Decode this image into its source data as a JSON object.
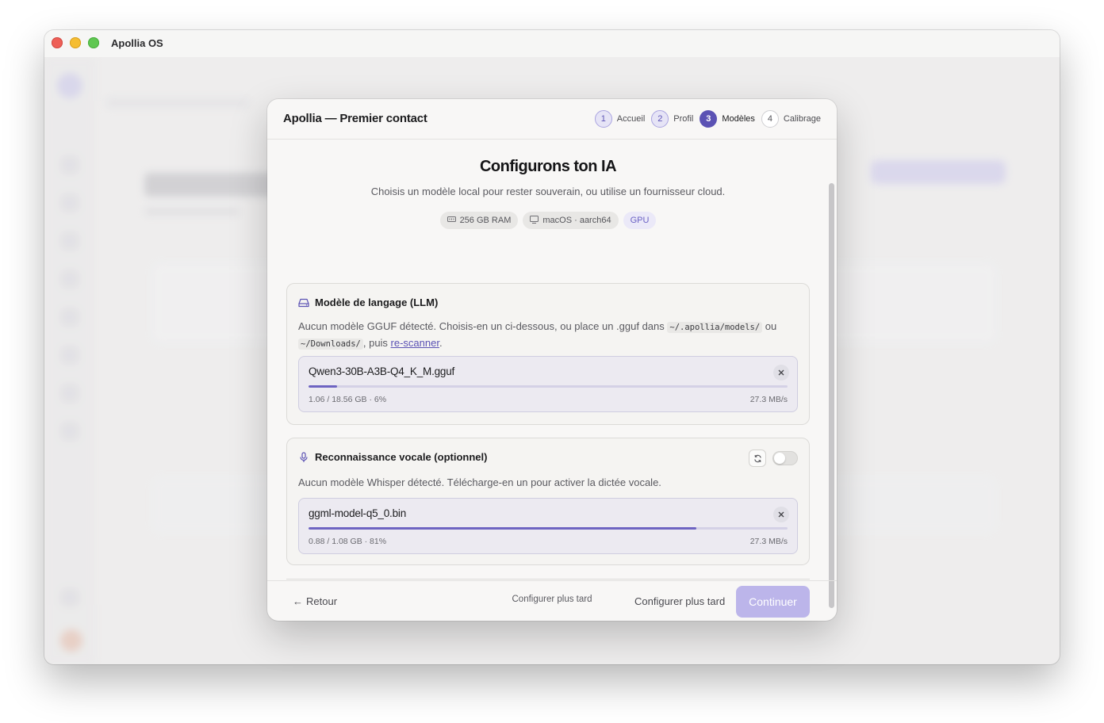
{
  "window": {
    "title": "Apollia OS"
  },
  "modal": {
    "title": "Apollia — Premier contact",
    "steps": [
      {
        "num": "1",
        "label": "Accueil",
        "state": "done"
      },
      {
        "num": "2",
        "label": "Profil",
        "state": "done"
      },
      {
        "num": "3",
        "label": "Modèles",
        "state": "active"
      },
      {
        "num": "4",
        "label": "Calibrage",
        "state": "todo"
      }
    ],
    "heading": "Configurons ton IA",
    "subheading": "Choisis un modèle local pour rester souverain, ou utilise un fournisseur cloud.",
    "chips": {
      "ram": "256 GB RAM",
      "os": "macOS · aarch64",
      "gpu": "GPU"
    },
    "llm": {
      "title": "Modèle de langage (LLM)",
      "desc_1": "Aucun modèle GGUF détecté. Choisis-en un ci-dessous, ou place un .gguf dans ",
      "path_1": "~/.apollia/models/",
      "desc_2": " ou ",
      "path_2": "~/Downloads/",
      "desc_3": ", puis ",
      "rescan_link": "re-scanner",
      "desc_4": ".",
      "download": {
        "file": "Qwen3-30B-A3B-Q4_K_M.gguf",
        "progress_pct": 6,
        "meta": "1.06 / 18.56 GB · 6%",
        "speed": "27.3 MB/s"
      }
    },
    "voice": {
      "title": "Reconnaissance vocale (optionnel)",
      "desc": "Aucun modèle Whisper détecté. Télécharge-en un pour activer la dictée vocale.",
      "enabled": false,
      "download": {
        "file": "ggml-model-q5_0.bin",
        "progress_pct": 81,
        "meta": "0.88 / 1.08 GB · 81%",
        "speed": "27.3 MB/s"
      }
    },
    "actions": {
      "back": "Retour",
      "later": "Configurer plus tard",
      "continue": "Continuer"
    },
    "footer_link": "Configurer plus tard"
  },
  "colors": {
    "accent": "#5b52b4",
    "progress": "#6e64c2",
    "continue_disabled": "#bcb5ea"
  }
}
